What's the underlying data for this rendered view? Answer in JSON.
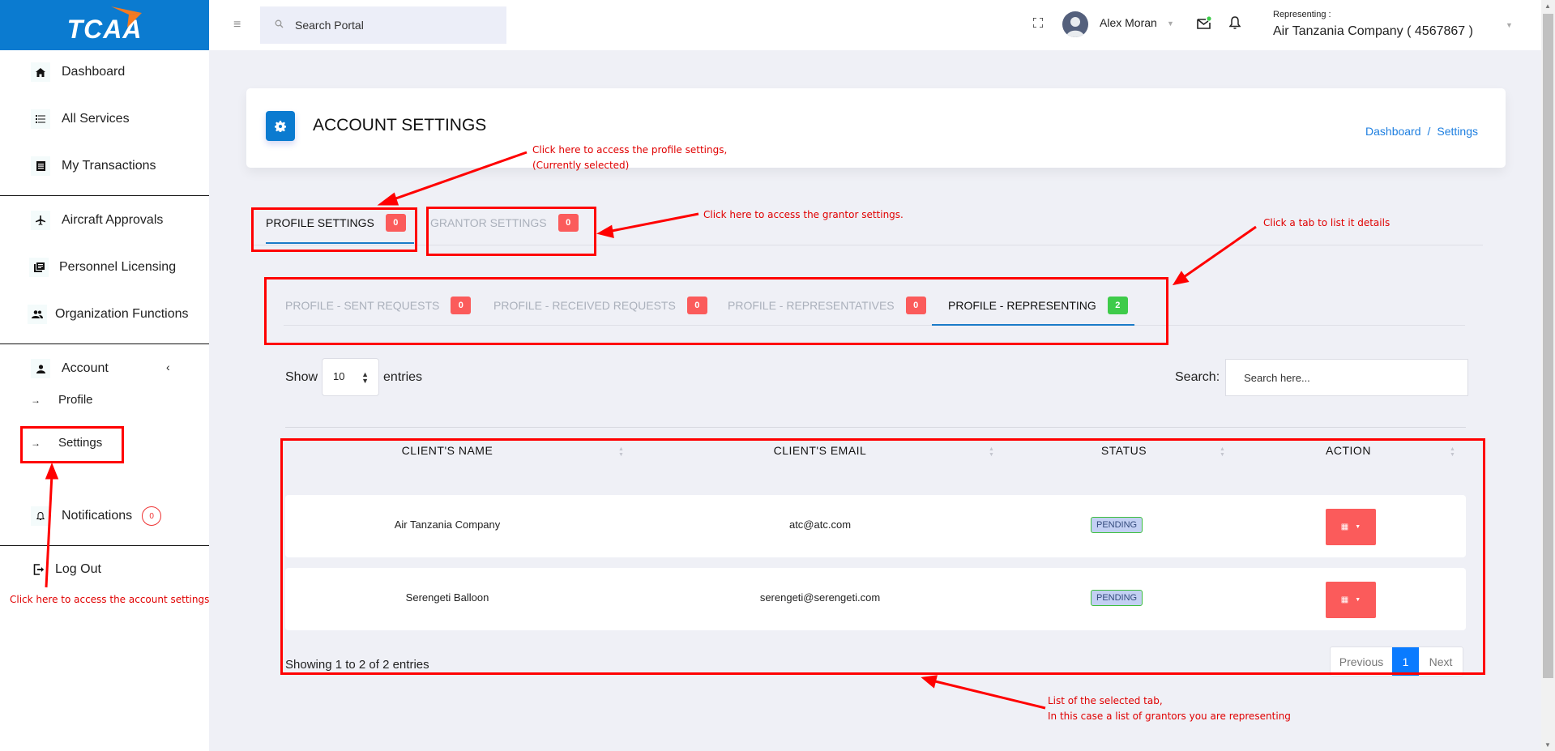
{
  "app": {
    "logo_text": "TCAA"
  },
  "sidebar": {
    "items": [
      {
        "label": "Dashboard",
        "icon": "home-icon"
      },
      {
        "label": "All Services",
        "icon": "list-icon"
      },
      {
        "label": "My Transactions",
        "icon": "receipt-icon"
      },
      {
        "label": "Aircraft Approvals",
        "icon": "plane-icon"
      },
      {
        "label": "Personnel Licensing",
        "icon": "license-icon"
      },
      {
        "label": "Organization Functions",
        "icon": "people-icon"
      },
      {
        "label": "Account",
        "icon": "user-icon"
      }
    ],
    "account_sub": [
      {
        "label": "Profile"
      },
      {
        "label": "Settings"
      }
    ],
    "notifications": {
      "label": "Notifications",
      "count": "0"
    },
    "logout": {
      "label": "Log Out"
    }
  },
  "topbar": {
    "search_placeholder": "Search Portal",
    "user_name": "Alex Moran",
    "representing_label": "Representing :",
    "representing_value": "Air Tanzania Company ( 4567867 )"
  },
  "header": {
    "title": "ACCOUNT SETTINGS",
    "breadcrumb": [
      "Dashboard",
      "Settings"
    ],
    "breadcrumb_sep": "/"
  },
  "primary_tabs": [
    {
      "label": "PROFILE SETTINGS",
      "count": "0",
      "active": true
    },
    {
      "label": "GRANTOR SETTINGS",
      "count": "0",
      "active": false
    }
  ],
  "secondary_tabs": [
    {
      "label": "PROFILE - SENT REQUESTS",
      "count": "0",
      "active": false
    },
    {
      "label": "PROFILE - RECEIVED REQUESTS",
      "count": "0",
      "active": false
    },
    {
      "label": "PROFILE - REPRESENTATIVES",
      "count": "0",
      "active": false
    },
    {
      "label": "PROFILE - REPRESENTING",
      "count": "2",
      "active": true
    }
  ],
  "table": {
    "show_label": "Show",
    "entries_value": "10",
    "entries_label": "entries",
    "search_label": "Search:",
    "search_placeholder": "Search here...",
    "columns": [
      "CLIENT'S NAME",
      "CLIENT'S EMAIL",
      "STATUS",
      "ACTION"
    ],
    "rows": [
      {
        "name": "Air Tanzania Company",
        "email": "atc@atc.com",
        "status": "PENDING"
      },
      {
        "name": "Serengeti Balloon",
        "email": "serengeti@serengeti.com",
        "status": "PENDING"
      }
    ],
    "info": "Showing 1 to 2 of 2 entries",
    "pagination": {
      "previous": "Previous",
      "current": "1",
      "next": "Next"
    }
  },
  "annotations": {
    "profile_settings": "Click here to access the profile settings,\n(Currently selected)",
    "grantor_settings": "Click here to access the grantor settings.",
    "tabs": "Click a tab to list it details",
    "account_settings": "Click here to access the account settings",
    "list": "List of the selected tab,\nIn this case a list of grantors you are representing"
  },
  "colors": {
    "brand": "#0b7bd0",
    "badge_red": "#fb5b5b",
    "badge_green": "#3ecb4a",
    "annotation": "#ff0000",
    "page_active": "#0a7bff"
  }
}
